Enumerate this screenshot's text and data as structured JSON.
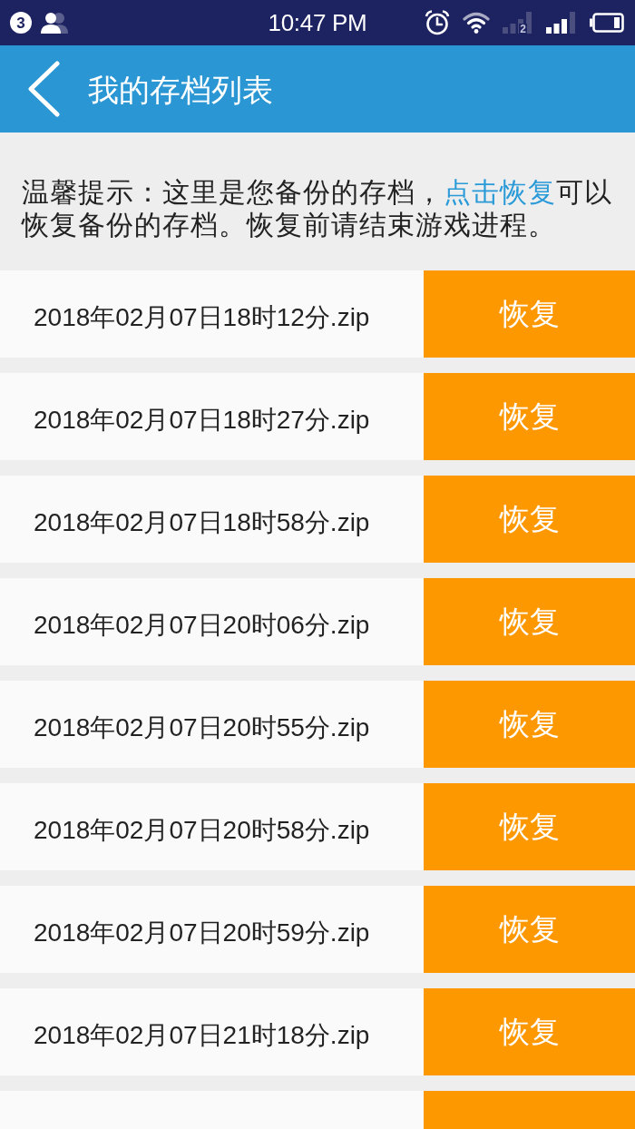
{
  "status_bar": {
    "notification_count": "3",
    "time": "10:47 PM",
    "signals": [
      {
        "sim_label": "2",
        "active": false
      },
      {
        "active": true
      }
    ]
  },
  "header": {
    "title": "我的存档列表"
  },
  "hint": {
    "text_before": "温馨提示：这里是您备份的存档，",
    "link": "点击恢复",
    "text_after": "可以恢复备份的存档。恢复前请结束游戏进程。"
  },
  "list": {
    "rows": [
      {
        "file_name": "2018年02月07日18时12分.zip",
        "button": "恢复"
      },
      {
        "file_name": "2018年02月07日18时27分.zip",
        "button": "恢复"
      },
      {
        "file_name": "2018年02月07日18时58分.zip",
        "button": "恢复"
      },
      {
        "file_name": "2018年02月07日20时06分.zip",
        "button": "恢复"
      },
      {
        "file_name": "2018年02月07日20时55分.zip",
        "button": "恢复"
      },
      {
        "file_name": "2018年02月07日20时58分.zip",
        "button": "恢复"
      },
      {
        "file_name": "2018年02月07日20时59分.zip",
        "button": "恢复"
      },
      {
        "file_name": "2018年02月07日21时18分.zip",
        "button": "恢复"
      }
    ],
    "cut_off_row": true
  }
}
